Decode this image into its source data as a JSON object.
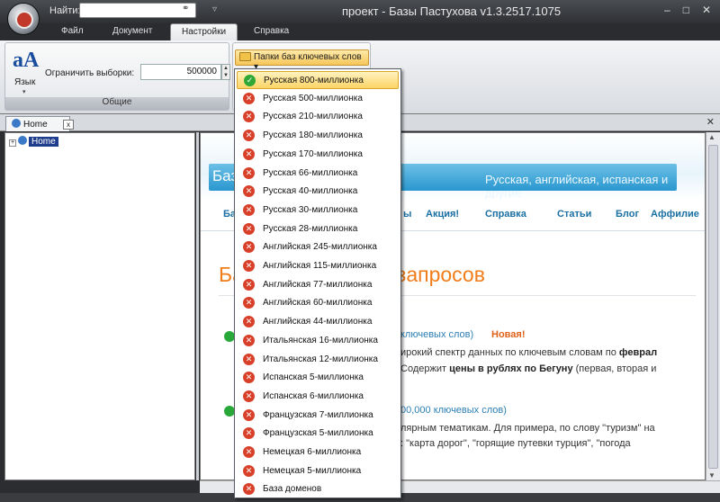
{
  "titlebar": {
    "find_label": "Найти:",
    "window_title": "проект - Базы Пастухова v1.3.2517.1075",
    "minimize": "–",
    "maximize": "□",
    "close": "✕"
  },
  "ribbon_tabs": [
    "Файл",
    "Документ",
    "Настройки",
    "Справка"
  ],
  "ribbon": {
    "lang_label": "Язык",
    "limit_label": "Ограничить выборки:",
    "limit_value": "500000",
    "group_label": "Общие",
    "folders_button": "Папки баз ключевых слов"
  },
  "doc_tab": {
    "label": "Home",
    "close": "x"
  },
  "tree": {
    "root_label": "Home"
  },
  "page": {
    "site_title": "Баз            астухова",
    "site_tagline": "Русская, английская, испанская и другие",
    "nav": [
      "Ба",
      "ы",
      "Акция!",
      "Справка",
      "Статьи",
      "Блог",
      "Аффилие"
    ],
    "heading": "Ба                  ов / поисковых запросов",
    "line1_blue": "ключевых слов)",
    "line1_new": "Новая!",
    "line2": "ирокий спектр данных по ключевым словам по",
    "line2_bold": "феврал",
    "line3": "Содержит",
    "line3_bold": "цены в рублях по Бегуну",
    "line3_tail": "(первая, вторая и",
    "line4_blue": "00,000 ключевых слов)",
    "line5": "лярным тематикам. Для примера, по слову \"туризм\" на",
    "line6": ": \"карта дорог\", \"горящие путевки турция\", \"погода"
  },
  "dropdown": {
    "items": [
      {
        "label": "Русская 800-миллионка",
        "state": "check"
      },
      {
        "label": "Русская 500-миллионка",
        "state": "x"
      },
      {
        "label": "Русская 210-миллионка",
        "state": "x"
      },
      {
        "label": "Русская 180-миллионка",
        "state": "x"
      },
      {
        "label": "Русская 170-миллионка",
        "state": "x"
      },
      {
        "label": "Русская 66-миллионка",
        "state": "x"
      },
      {
        "label": "Русская 40-миллионка",
        "state": "x"
      },
      {
        "label": "Русская 30-миллионка",
        "state": "x"
      },
      {
        "label": "Русская 28-миллионка",
        "state": "x"
      },
      {
        "label": "Английская 245-миллионка",
        "state": "x"
      },
      {
        "label": "Английская 115-миллионка",
        "state": "x"
      },
      {
        "label": "Английская 77-миллионка",
        "state": "x"
      },
      {
        "label": "Английская 60-миллионка",
        "state": "x"
      },
      {
        "label": "Английская 44-миллионка",
        "state": "x"
      },
      {
        "label": "Итальянская 16-миллионка",
        "state": "x"
      },
      {
        "label": "Итальянская 12-миллионка",
        "state": "x"
      },
      {
        "label": "Испанская 5-миллионка",
        "state": "x"
      },
      {
        "label": "Испанская 6-миллионка",
        "state": "x"
      },
      {
        "label": "Французская 7-миллионка",
        "state": "x"
      },
      {
        "label": "Французская 5-миллионка",
        "state": "x"
      },
      {
        "label": "Немецкая 6-миллионка",
        "state": "x"
      },
      {
        "label": "Немецкая 5-миллионка",
        "state": "x"
      },
      {
        "label": "База доменов",
        "state": "x"
      }
    ]
  },
  "icons": {
    "check": "✓",
    "x": "✕",
    "spin_up": "▲",
    "spin_down": "▼",
    "dropdown_arrow": "▾",
    "binoculars": "⚭",
    "quick_access": "▿",
    "tree_toggle": "+",
    "scroll_up": "▲",
    "scroll_down": "▼",
    "doc_tabs_close": "✕",
    "lang_glyph": "aA"
  },
  "colors": {
    "accent_orange": "#f07c1a",
    "link_blue": "#1a6fa3",
    "check_green": "#2fa836",
    "x_red": "#d8402a"
  }
}
